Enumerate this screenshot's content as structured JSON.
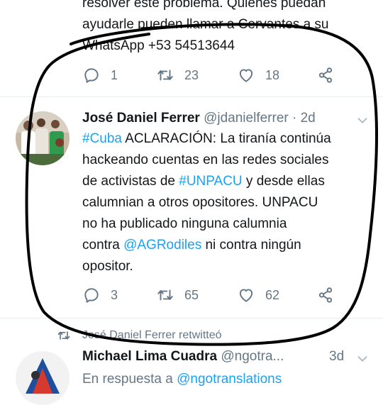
{
  "prev_tweet": {
    "text_line1": "resolver este problema. Quienes puedan",
    "text_line2": "ayudarle pueden llamar a Cervantes a su",
    "text_line3": "WhatsApp +53 54513644",
    "replies": "1",
    "retweets": "23",
    "likes": "18"
  },
  "main_tweet": {
    "author_name": "José Daniel Ferrer",
    "author_handle": "@jdanielferrer",
    "time": "· 2d",
    "hashtag_cuba": "#Cuba",
    "line1_rest": " ACLARACIÓN: La tiranía continúa",
    "line2": "hackeando cuentas en las redes sociales",
    "line3_a": "de activistas de ",
    "hashtag_unpacu": "#UNPACU",
    "line3_b": " y desde ellas",
    "line4": "calumnian a otros opositores. UNPACU",
    "line5": "no ha publicado ninguna calumnia",
    "line6_a": "contra ",
    "mention": "@AGRodiles",
    "line6_b": " ni contra ningún",
    "line7": "opositor.",
    "replies": "3",
    "retweets": "65",
    "likes": "62"
  },
  "next_tweet": {
    "retweet_label": "José Daniel Ferrer retwitteó",
    "author_name": "Michael Lima Cuadra",
    "author_handle": "@ngotra...",
    "time": "3d",
    "reply_prefix": "En respuesta a ",
    "reply_to": "@ngotranslations"
  },
  "colors": {
    "link": "#1da1f2",
    "muted": "#657786",
    "annotation_stroke": "#000000"
  },
  "icons": [
    "reply-icon",
    "retweet-icon",
    "like-icon",
    "share-icon",
    "chevron-down-icon"
  ]
}
